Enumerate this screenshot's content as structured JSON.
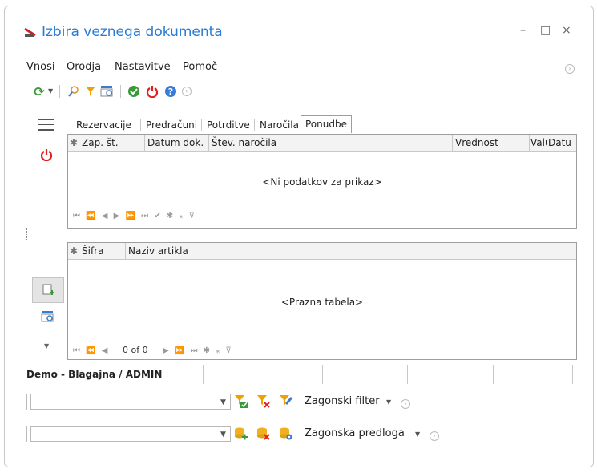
{
  "window": {
    "title": "Izbira veznega dokumenta",
    "minimize": "–",
    "maximize": "□",
    "close": "×"
  },
  "menu": {
    "items": [
      "Vnosi",
      "Orodja",
      "Nastavitve",
      "Pomoč"
    ]
  },
  "tabs": [
    "Rezervacije",
    "Predračuni",
    "Potrditve",
    "Naročila",
    "Ponudbe"
  ],
  "upper_grid": {
    "columns": [
      "Zap. št.",
      "Datum dok.",
      "Štev. naročila",
      "Vrednost",
      "Valu",
      "Datu"
    ],
    "empty_text": "<Ni podatkov za prikaz>",
    "nav": "⏮ ⏪ ◀ ▶ ⏩ ⏭ ✔ ✱ ⁎ ⊽"
  },
  "lower_grid": {
    "columns": [
      "Šifra",
      "Naziv artikla"
    ],
    "empty_text": "<Prazna tabela>",
    "nav_left": "⏮ ⏪ ◀",
    "record": "0 of 0",
    "nav_right": "▶ ⏩ ⏭ ✱ ⁎ ⊽"
  },
  "status": {
    "label": "Demo - Blagajna / ADMIN"
  },
  "filter": {
    "combo_value": "",
    "label": "Zagonski filter"
  },
  "template": {
    "combo_value": "",
    "label": "Zagonska predloga"
  },
  "colors": {
    "title": "#2a7bd4",
    "power": "#e02020",
    "green": "#3a9a3a",
    "filter": "#f0a000",
    "help": "#3a7bd5"
  }
}
